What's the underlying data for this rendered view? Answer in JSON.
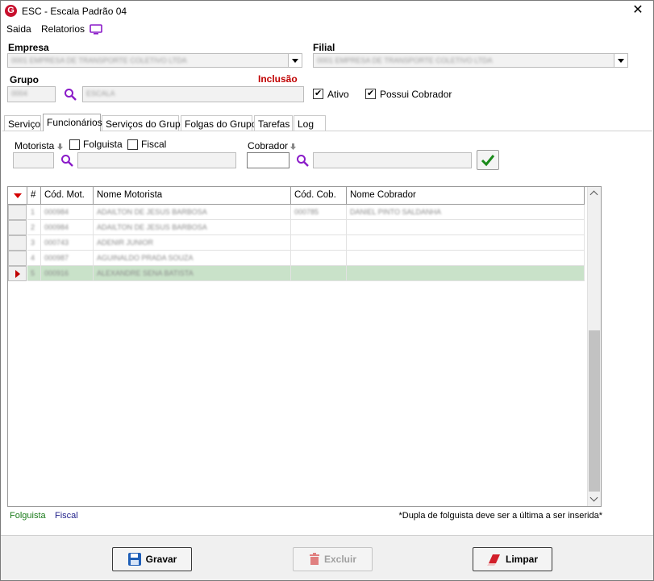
{
  "window": {
    "title": "ESC - Escala Padrão 04",
    "logo_letter": "G"
  },
  "menu": {
    "items": [
      "Saida",
      "Relatorios"
    ]
  },
  "form": {
    "empresa_label": "Empresa",
    "empresa_value": "0001 EMPRESA DE TRANSPORTE COLETIVO LTDA",
    "filial_label": "Filial",
    "filial_value": "0001 EMPRESA DE TRANSPORTE COLETIVO LTDA",
    "grupo_label": "Grupo",
    "grupo_code": "0004",
    "grupo_desc": "ESCALA",
    "mode_label": "Inclusão",
    "ativo_label": "Ativo",
    "ativo_checked": true,
    "possui_cobrador_label": "Possui Cobrador",
    "possui_cobrador_checked": true
  },
  "tabs": [
    "Serviço",
    "Funcionários",
    "Serviços do Grupo",
    "Folgas do Grupo",
    "Tarefas",
    "Log"
  ],
  "active_tab": "Funcionários",
  "filters": {
    "motorista_label": "Motorista",
    "folguista_label": "Folguista",
    "fiscal_label": "Fiscal",
    "cobrador_label": "Cobrador"
  },
  "grid": {
    "columns": [
      "#",
      "Cód. Mot.",
      "Nome Motorista",
      "Cód. Cob.",
      "Nome Cobrador"
    ],
    "rows": [
      {
        "n": "1",
        "cod_mot": "000984",
        "nome_mot": "ADAILTON DE JESUS BARBOSA",
        "cod_cob": "000785",
        "nome_cob": "DANIEL PINTO SALDANHA"
      },
      {
        "n": "2",
        "cod_mot": "000984",
        "nome_mot": "ADAILTON DE JESUS BARBOSA",
        "cod_cob": "",
        "nome_cob": ""
      },
      {
        "n": "3",
        "cod_mot": "000743",
        "nome_mot": "ADENIR JUNIOR",
        "cod_cob": "",
        "nome_cob": ""
      },
      {
        "n": "4",
        "cod_mot": "000987",
        "nome_mot": "AGUINALDO PRADA SOUZA",
        "cod_cob": "",
        "nome_cob": ""
      },
      {
        "n": "5",
        "cod_mot": "000916",
        "nome_mot": "ALEXANDRE SENA BATISTA",
        "cod_cob": "",
        "nome_cob": ""
      }
    ],
    "selected_row": 4
  },
  "legend": {
    "folguista": "Folguista",
    "fiscal": "Fiscal",
    "folguista_color": "#1a7a1a",
    "fiscal_color": "#1f1f8a"
  },
  "note": "*Dupla de folguista deve ser a última a ser inserida*",
  "buttons": {
    "gravar": "Gravar",
    "excluir": "Excluir",
    "limpar": "Limpar"
  },
  "colors": {
    "accent_purple": "#8a1ac8",
    "mode_red": "#c00000",
    "selected_row": "#c9e2c9"
  }
}
